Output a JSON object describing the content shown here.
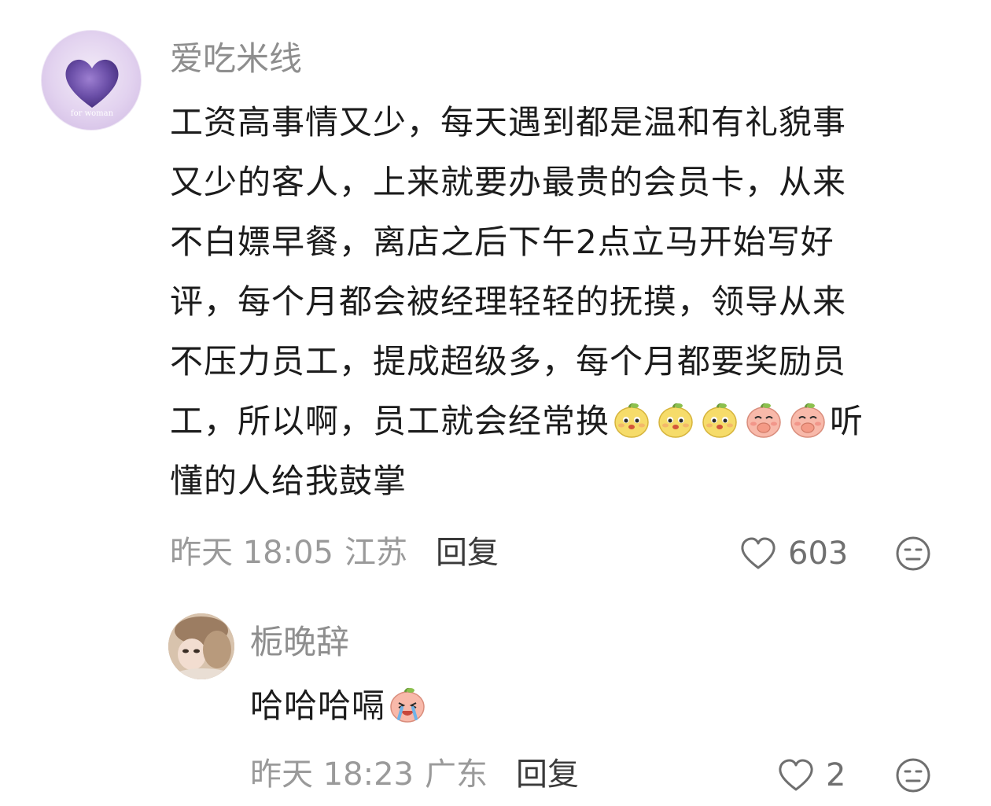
{
  "comment": {
    "username": "爱吃米线",
    "avatar_caption": "for woman",
    "lines": [
      "工资高事情又少，每天遇到都是温和有礼貌事",
      "又少的客人，上来就要办最贵的会员卡，从来",
      "不白嫖早餐，离店之后下午2点立马开始写好",
      "评，每个月都会被经理轻轻的抚摸，领导从来",
      "不压力员工，提成超级多，每个月都要奖励员"
    ],
    "line6_text": "工，所以啊，员工就会经常换",
    "line6_after": "听",
    "line7": "懂的人给我鼓掌",
    "emojis": [
      "yellow-smile-emoji",
      "yellow-smile-emoji",
      "yellow-smile-emoji",
      "pink-cover-mouth-emoji",
      "pink-cover-mouth-emoji"
    ],
    "time": "昨天 18:05",
    "location": "江苏",
    "reply_label": "回复",
    "likes": "603",
    "like_icon": "heart-outline-icon",
    "dislike_icon": "meh-face-icon"
  },
  "reply": {
    "username": "栀晚辞",
    "text": "哈哈哈嗝",
    "emoji": "pink-crying-laugh-emoji",
    "time": "昨天 18:23",
    "location": "广东",
    "reply_label": "回复",
    "likes": "2",
    "like_icon": "heart-outline-icon",
    "dislike_icon": "meh-face-icon"
  },
  "colors": {
    "text": "#1c1c1c",
    "muted": "#9a9a9a",
    "username": "#8e8e8e",
    "heart_purple": "#6b4fa8"
  }
}
